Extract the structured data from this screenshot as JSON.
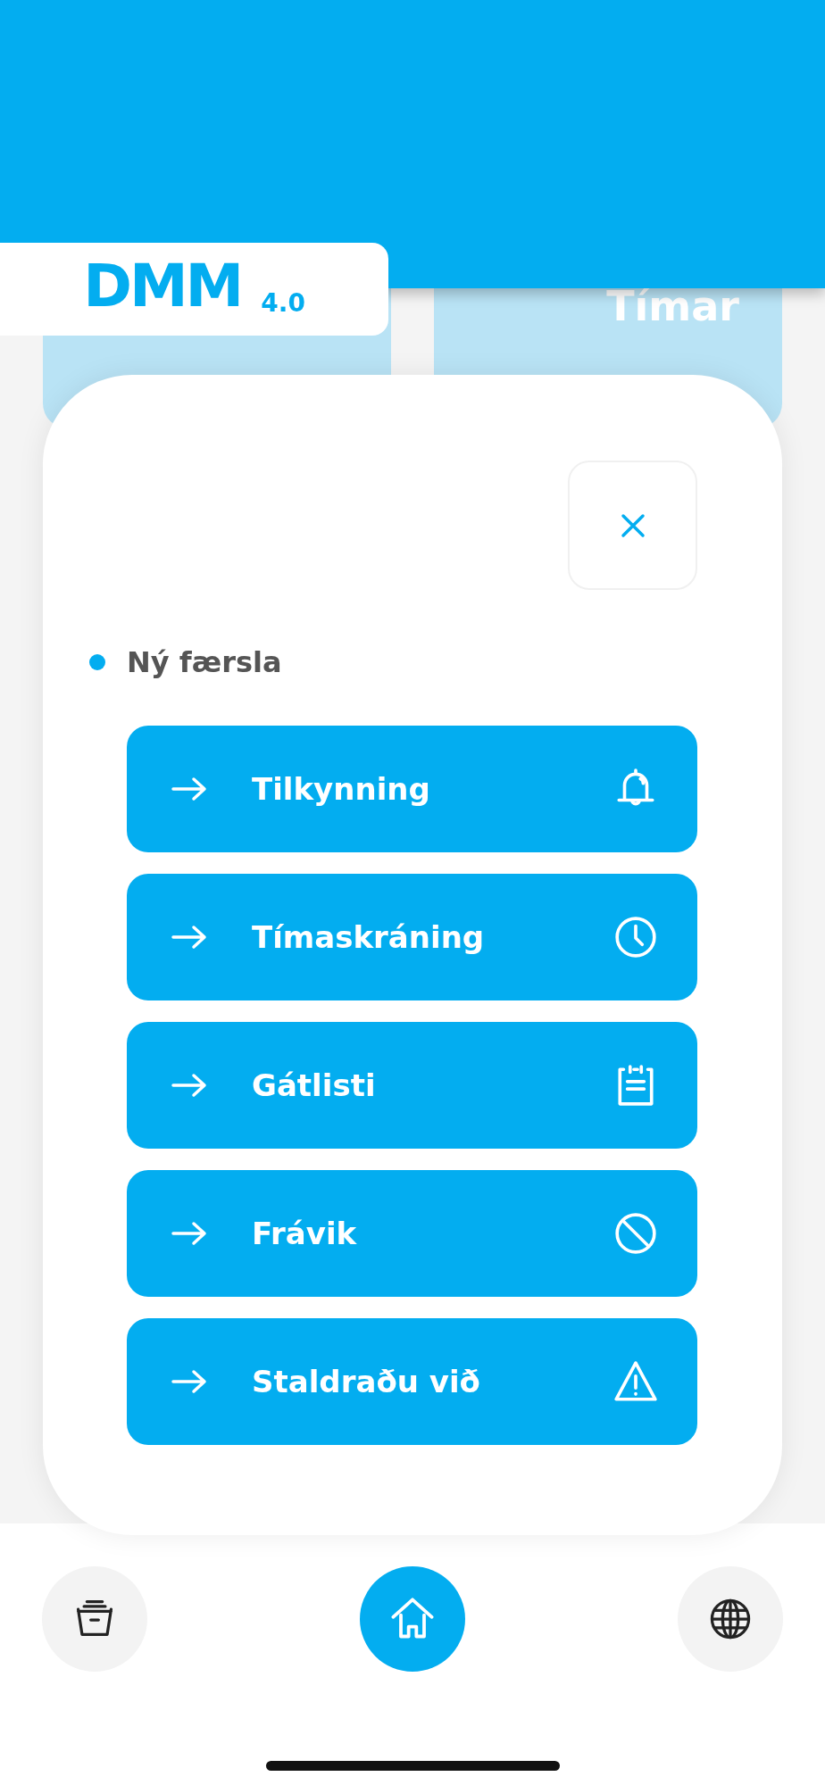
{
  "logo": {
    "name": "DMM",
    "version": "4.0"
  },
  "background_card": {
    "title": "Tímar"
  },
  "modal": {
    "section_title": "Ný færsla",
    "actions": [
      {
        "label": "Tilkynning",
        "kind": "bell"
      },
      {
        "label": "Tímaskráning",
        "kind": "clock"
      },
      {
        "label": "Gátlisti",
        "kind": "clipboard"
      },
      {
        "label": "Frávik",
        "kind": "ban"
      },
      {
        "label": "Staldraðu við",
        "kind": "warning"
      }
    ]
  },
  "bottom_nav": [
    {
      "kind": "archive",
      "selected": false
    },
    {
      "kind": "home",
      "selected": true
    },
    {
      "kind": "globe",
      "selected": false
    }
  ]
}
